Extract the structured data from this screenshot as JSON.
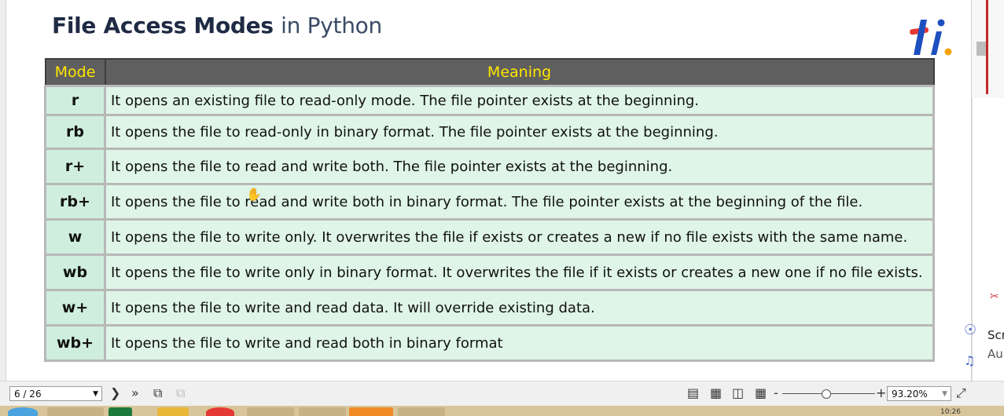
{
  "slide": {
    "title_main": "File Access Modes",
    "title_accent": "in Python",
    "logo_text": "ti."
  },
  "table": {
    "headers": [
      "Mode",
      "Meaning"
    ],
    "rows": [
      {
        "mode": "r",
        "meaning": "It opens an existing file to read-only mode. The file pointer exists at the beginning."
      },
      {
        "mode": "rb",
        "meaning": "It opens the file to read-only in binary format. The file pointer exists at the beginning."
      },
      {
        "mode": "r+",
        "meaning": "It opens the file to read and write both. The file pointer exists at the beginning."
      },
      {
        "mode": "rb+",
        "meaning": "It opens the file to read and write both in binary format. The file pointer exists at the beginning of the file."
      },
      {
        "mode": "w",
        "meaning": "It opens the file to write only. It overwrites the file if exists or creates a new if no file exists with the same name."
      },
      {
        "mode": "wb",
        "meaning": "It opens the file to write only in binary format. It overwrites the file if it exists or creates a new one if no file exists."
      },
      {
        "mode": "w+",
        "meaning": "It opens the file to write and read data. It will override existing data."
      },
      {
        "mode": "wb+",
        "meaning": "It opens the file to write and read both in binary format"
      }
    ]
  },
  "toolbar": {
    "page_indicator": "6 / 26",
    "next_icon": "chevron-right",
    "last_icon": "double-chevron-right",
    "zoom_minus": "-",
    "zoom_plus": "+",
    "zoom_level": "93.20%",
    "zoom_fraction": 0.43
  },
  "side_panel": {
    "text_line1": "Scr",
    "text_line2": "Au"
  },
  "colors": {
    "header_bg": "#5f5f5f",
    "header_text": "#ffe600",
    "row_bg": "#dff5e8",
    "mode_bg": "#cfeedd",
    "title": "#1f2a44",
    "logo_blue": "#1d4fbf",
    "logo_red": "#e53935",
    "taskbar": "#d8c59a"
  }
}
